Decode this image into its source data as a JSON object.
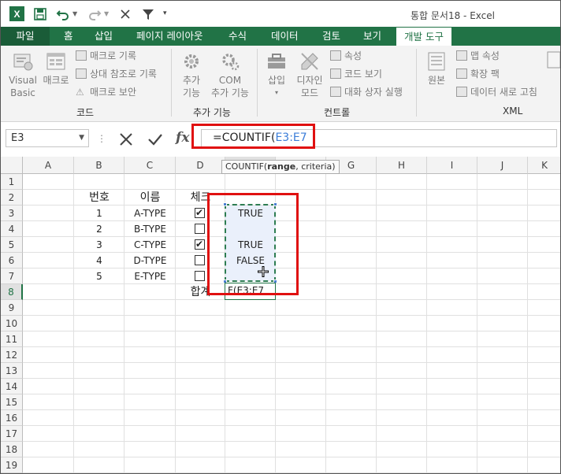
{
  "window": {
    "title": "통합 문서18 - Excel",
    "app_logo": "X"
  },
  "quick_access": {
    "icons": [
      "save-icon",
      "undo-icon",
      "redo-icon",
      "close-icon",
      "filter-icon",
      "customize-icon"
    ]
  },
  "tabs": [
    "파일",
    "홈",
    "삽입",
    "페이지 레이아웃",
    "수식",
    "데이터",
    "검토",
    "보기",
    "개발 도구"
  ],
  "ribbon": {
    "code": {
      "visual_basic_1": "Visual",
      "visual_basic_2": "Basic",
      "macro": "매크로",
      "record_macro": "매크로 기록",
      "relative_ref": "상대 참조로 기록",
      "macro_security": "매크로 보안",
      "group_label": "코드"
    },
    "addins": {
      "addins_1": "추가",
      "addins_2": "기능",
      "com_1": "COM",
      "com_2": "추가 기능",
      "group_label": "추가 기능"
    },
    "controls": {
      "insert": "삽입",
      "design_1": "디자인",
      "design_2": "모드",
      "properties": "속성",
      "view_code": "코드 보기",
      "run_dialog": "대화 상자 실행",
      "group_label": "컨트롤"
    },
    "xml": {
      "source": "원본",
      "map_properties": "맵 속성",
      "expansion_packs": "확장 팩",
      "refresh_data": "데이터 새로 고침",
      "group_label": "XML"
    }
  },
  "formula_bar": {
    "name_box": "E3",
    "formula_prefix": "=COUNTIF(",
    "formula_ref": "E3:E7",
    "fx": "fx",
    "tooltip_prefix": "COUNTIF(",
    "tooltip_bold": "range",
    "tooltip_suffix": ", criteria)"
  },
  "sheet": {
    "columns": [
      "A",
      "B",
      "C",
      "D",
      "E",
      "F",
      "G",
      "H",
      "I",
      "J",
      "K"
    ],
    "rows": [
      "1",
      "2",
      "3",
      "4",
      "5",
      "6",
      "7",
      "8",
      "9",
      "10",
      "11",
      "12",
      "13",
      "14",
      "15",
      "16",
      "17",
      "18",
      "19"
    ],
    "headers": {
      "number": "번호",
      "name": "이름",
      "check": "체크"
    },
    "data": [
      {
        "no": "1",
        "name": "A-TYPE",
        "checked": true,
        "value": "TRUE"
      },
      {
        "no": "2",
        "name": "B-TYPE",
        "checked": false,
        "value": ""
      },
      {
        "no": "3",
        "name": "C-TYPE",
        "checked": true,
        "value": "TRUE"
      },
      {
        "no": "4",
        "name": "D-TYPE",
        "checked": false,
        "value": "FALSE"
      },
      {
        "no": "5",
        "name": "E-TYPE",
        "checked": false,
        "value": ""
      }
    ],
    "total_label": "합계",
    "editing_text": "F(E3:E7"
  },
  "colors": {
    "excel_green": "#217346",
    "highlight_red": "#e01010",
    "ref_blue": "#3b7dd8"
  }
}
